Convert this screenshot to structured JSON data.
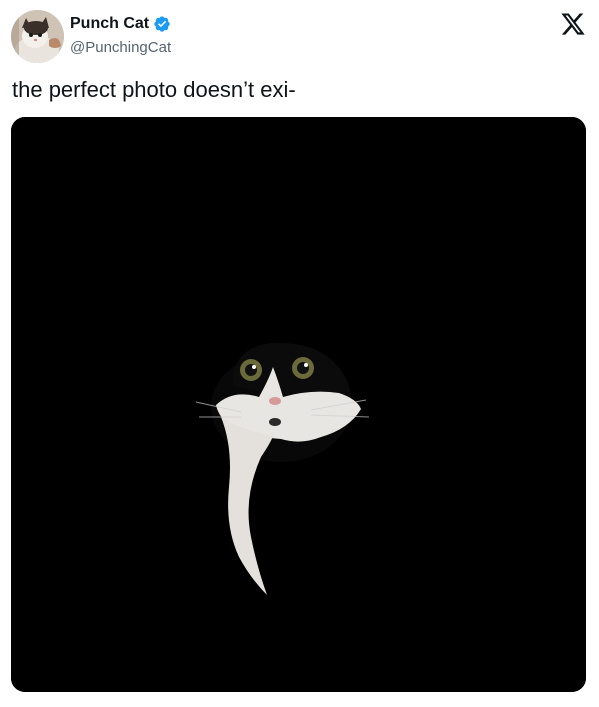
{
  "author": {
    "display_name": "Punch Cat",
    "handle": "@PunchingCat",
    "verified": true,
    "avatar_icon": "cat-avatar-icon"
  },
  "platform": {
    "logo_icon": "x-logo-icon"
  },
  "tweet": {
    "text": "the perfect photo doesn’t exi-"
  },
  "media": {
    "type": "photo",
    "subject": "black-and-white cat peeking out of darkness",
    "background_color": "#000000"
  },
  "colors": {
    "text_primary": "#0f1419",
    "text_secondary": "#536471",
    "verified_blue": "#1d9bf0"
  }
}
